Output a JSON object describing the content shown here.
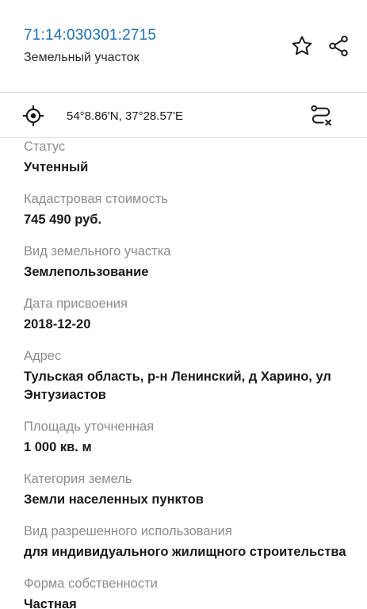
{
  "header": {
    "cadastral_number": "71:14:030301:2715",
    "object_type": "Земельный участок",
    "favorite_icon": "star-outline-icon",
    "share_icon": "share-icon"
  },
  "location": {
    "locate_icon": "crosshair-icon",
    "coordinates": "54°8.86'N, 37°28.57'E",
    "route_icon": "route-icon"
  },
  "fields": [
    {
      "label": "Статус",
      "value": "Учтенный"
    },
    {
      "label": "Кадастровая стоимость",
      "value": "745 490 руб."
    },
    {
      "label": "Вид земельного участка",
      "value": "Землепользование"
    },
    {
      "label": "Дата присвоения",
      "value": "2018-12-20"
    },
    {
      "label": "Адрес",
      "value": "Тульская область, р-н Ленинский, д Харино, ул Энтузиастов"
    },
    {
      "label": "Площадь уточненная",
      "value": "1 000 кв. м"
    },
    {
      "label": "Категория земель",
      "value": "Земли населенных пунктов"
    },
    {
      "label": "Вид разрешенного использования",
      "value": "для индивидуального жилищного строительства"
    },
    {
      "label": "Форма собственности",
      "value": "Частная"
    }
  ],
  "colors": {
    "link": "#1b6fb3",
    "label": "#8c8c8c",
    "value": "#1a1a1a",
    "divider": "#e2e2e2"
  }
}
